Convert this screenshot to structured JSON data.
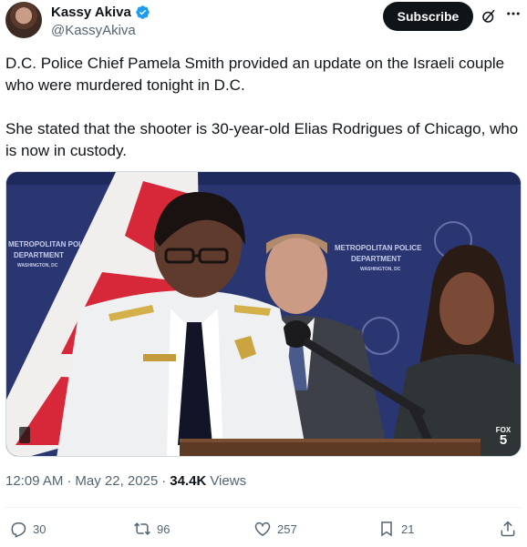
{
  "author": {
    "name": "Kassy Akiva",
    "handle": "@KassyAkiva"
  },
  "header": {
    "subscribe_label": "Subscribe"
  },
  "tweet": {
    "paragraphs": [
      "D.C. Police Chief Pamela Smith provided an update on the Israeli couple who were murdered tonight in D.C.",
      "She stated that the shooter is 30-year-old Elias Rodrigues of Chicago, who is now in custody."
    ]
  },
  "media": {
    "backdrop_text": [
      "METROPOLITAN POLICE",
      "DEPARTMENT",
      "WASHINGTON, DC",
      "METROPOLITAN POLICE",
      "DEPARTMENT",
      "WASHINGTON, DC"
    ],
    "badge_network": "FOX",
    "badge_channel": "5"
  },
  "meta": {
    "time": "12:09 AM",
    "separator": "·",
    "date": "May 22, 2025",
    "views_count": "34.4K",
    "views_label": "Views"
  },
  "actions": {
    "replies": "30",
    "reposts": "96",
    "likes": "257",
    "bookmarks": "21"
  },
  "colors": {
    "text_primary": "#0f1419",
    "text_secondary": "#536471",
    "verified": "#1d9bf0",
    "backdrop": "#27336b"
  },
  "icons": [
    "verified-badge-icon",
    "grok-icon",
    "more-icon",
    "reply-icon",
    "repost-icon",
    "like-icon",
    "bookmark-icon",
    "share-icon"
  ]
}
